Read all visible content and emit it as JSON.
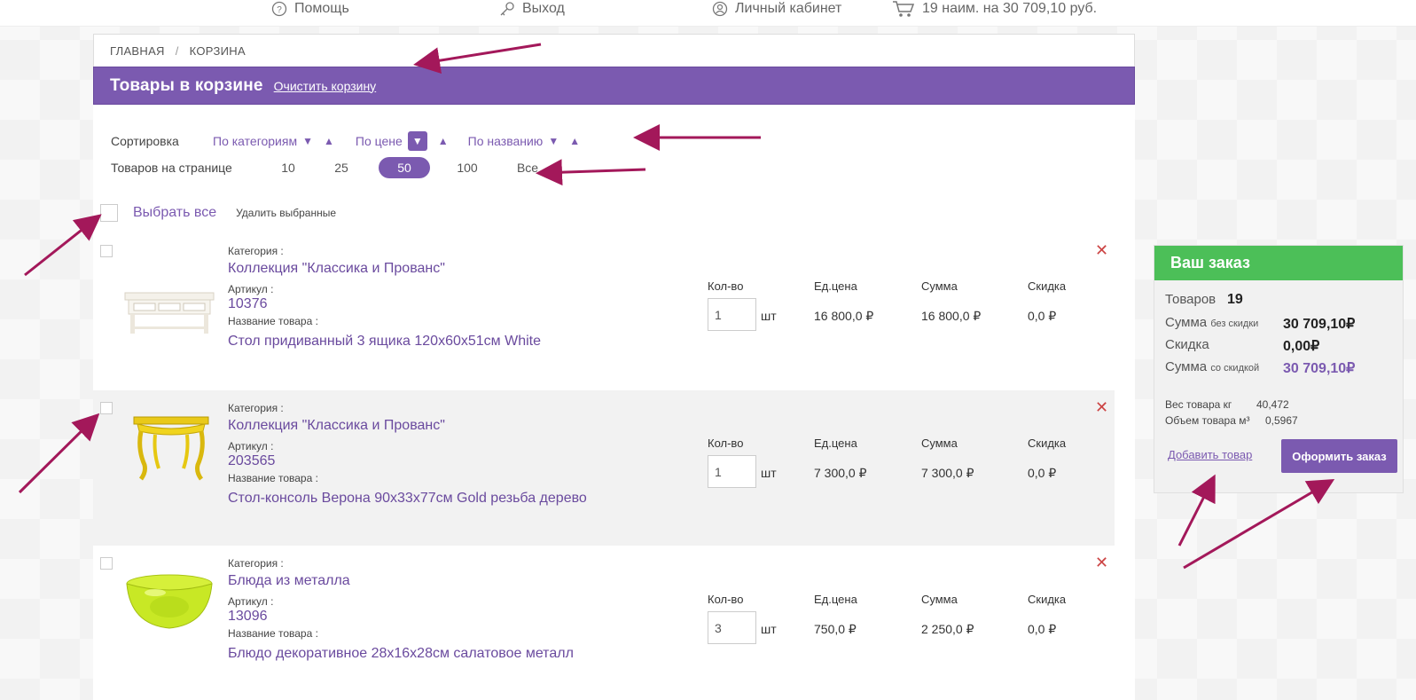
{
  "topbar": {
    "help": "Помощь",
    "exit": "Выход",
    "cabinet": "Личный кабинет",
    "cart_summary": "19 наим. на 30 709,10 руб."
  },
  "breadcrumb": {
    "home": "ГЛАВНАЯ",
    "separator": "/",
    "current": "КОРЗИНА"
  },
  "header": {
    "title": "Товары в корзине",
    "clear_link": "Очистить корзину"
  },
  "sorting": {
    "label": "Сортировка",
    "by_category": "По категориям",
    "by_price": "По цене",
    "by_name": "По названию",
    "down_arrow": "▼",
    "up_arrow": "▲"
  },
  "per_page": {
    "label": "Товаров на странице",
    "options": [
      "10",
      "25",
      "50",
      "100",
      "Все"
    ],
    "selected": "50"
  },
  "selection": {
    "select_all": "Выбрать все",
    "delete_selected": "Удалить выбранные"
  },
  "labels": {
    "category": "Категория :",
    "article": "Артикул :",
    "product_name": "Название товара :",
    "qty": "Кол-во",
    "unit_price": "Ед.цена",
    "sum": "Сумма",
    "discount": "Скидка",
    "unit": "шт",
    "remove": "✕"
  },
  "items": [
    {
      "category": "Коллекция \"Классика и Прованс\"",
      "article": "10376",
      "name": "Стол придиванный 3 ящика 120х60х51см White",
      "qty": "1",
      "unit_price": "16 800,0 ₽",
      "sum": "16 800,0 ₽",
      "discount": "0,0 ₽"
    },
    {
      "category": "Коллекция \"Классика и Прованс\"",
      "article": "203565",
      "name": "Стол-консоль Верона 90х33х77см Gold резьба дерево",
      "qty": "1",
      "unit_price": "7 300,0 ₽",
      "sum": "7 300,0 ₽",
      "discount": "0,0 ₽"
    },
    {
      "category": "Блюда из металла",
      "article": "13096",
      "name": "Блюдо декоративное 28х16х28см салатовое металл",
      "qty": "3",
      "unit_price": "750,0 ₽",
      "sum": "2 250,0 ₽",
      "discount": "0,0 ₽"
    }
  ],
  "order": {
    "title": "Ваш заказ",
    "goods_label": "Товаров",
    "goods_count": "19",
    "sum_label": "Сумма",
    "sum_small": "без скидки",
    "sum_value": "30 709,10₽",
    "discount_label": "Скидка",
    "discount_value": "0,00₽",
    "sum_disc_label": "Сумма",
    "sum_disc_small": "со скидкой",
    "sum_disc_value": "30 709,10₽",
    "weight_label": "Вес товара кг",
    "weight_value": "40,472",
    "volume_label": "Объем товара м³",
    "volume_value": "0,5967",
    "add_link": "Добавить товар",
    "checkout_button": "Оформить заказ"
  },
  "colors": {
    "accent": "#7b5ab0",
    "order_header": "#4cbf58",
    "remove": "#cc4444",
    "annotation_arrow": "#a3185a"
  }
}
